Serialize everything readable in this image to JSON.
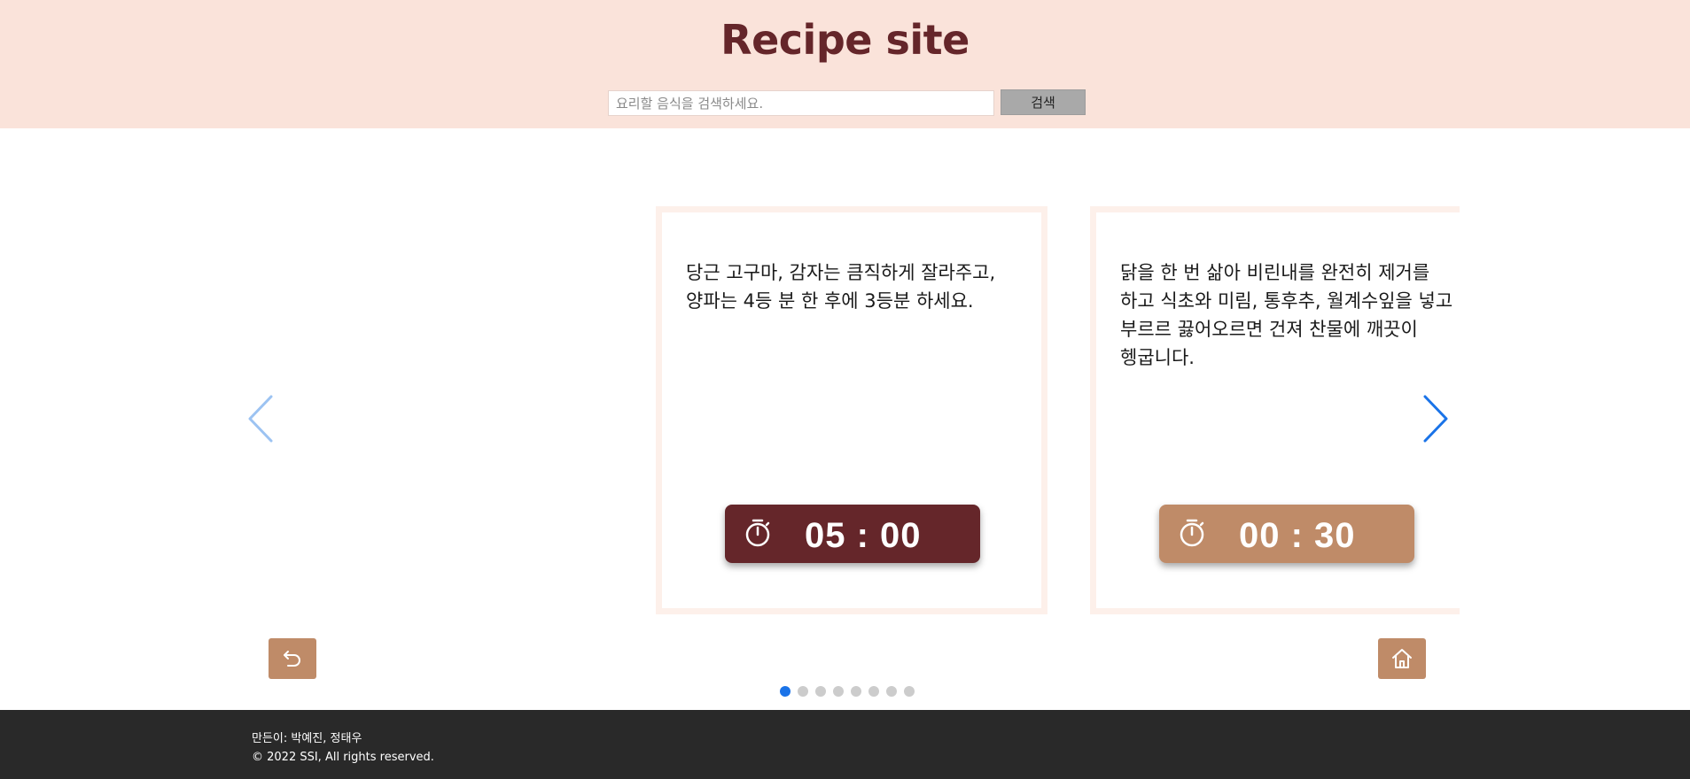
{
  "header": {
    "title": "Recipe site",
    "search_placeholder": "요리할 음식을 검색하세요.",
    "search_value": "",
    "search_button": "검색"
  },
  "colors": {
    "header_bg": "#fae3da",
    "title": "#65262a",
    "timer_active": "#65262a",
    "timer_inactive": "#bf8b68",
    "button_bg": "#bf8b68",
    "active_dot": "#1a73e8",
    "footer_bg": "#292929"
  },
  "carousel": {
    "cards": [
      {
        "instruction": "당근 고구마, 감자는 큼직하게 잘라주고, 양파는 4등 분 한 후에 3등분 하세요.",
        "timer": "05 : 00",
        "timer_icon": "stopwatch-icon",
        "timer_state": "active"
      },
      {
        "instruction": "닭을 한 번 삶아 비린내를 완전히 제거를 하고 식초와 미림, 통후추, 월계수잎을 넣고 부르르 끓어오르면 건져 찬물에 깨끗이 헹굽니다.",
        "timer": "00 : 30",
        "timer_icon": "stopwatch-icon",
        "timer_state": "inactive"
      }
    ],
    "prev_icon": "chevron-left-icon",
    "next_icon": "chevron-right-icon",
    "page_count": 8,
    "active_page": 1
  },
  "buttons": {
    "back_icon": "undo-arrow-icon",
    "home_icon": "home-icon"
  },
  "footer": {
    "credits": "만든이: 박예진, 정태우",
    "copyright": "© 2022 SSI, All rights reserved."
  }
}
